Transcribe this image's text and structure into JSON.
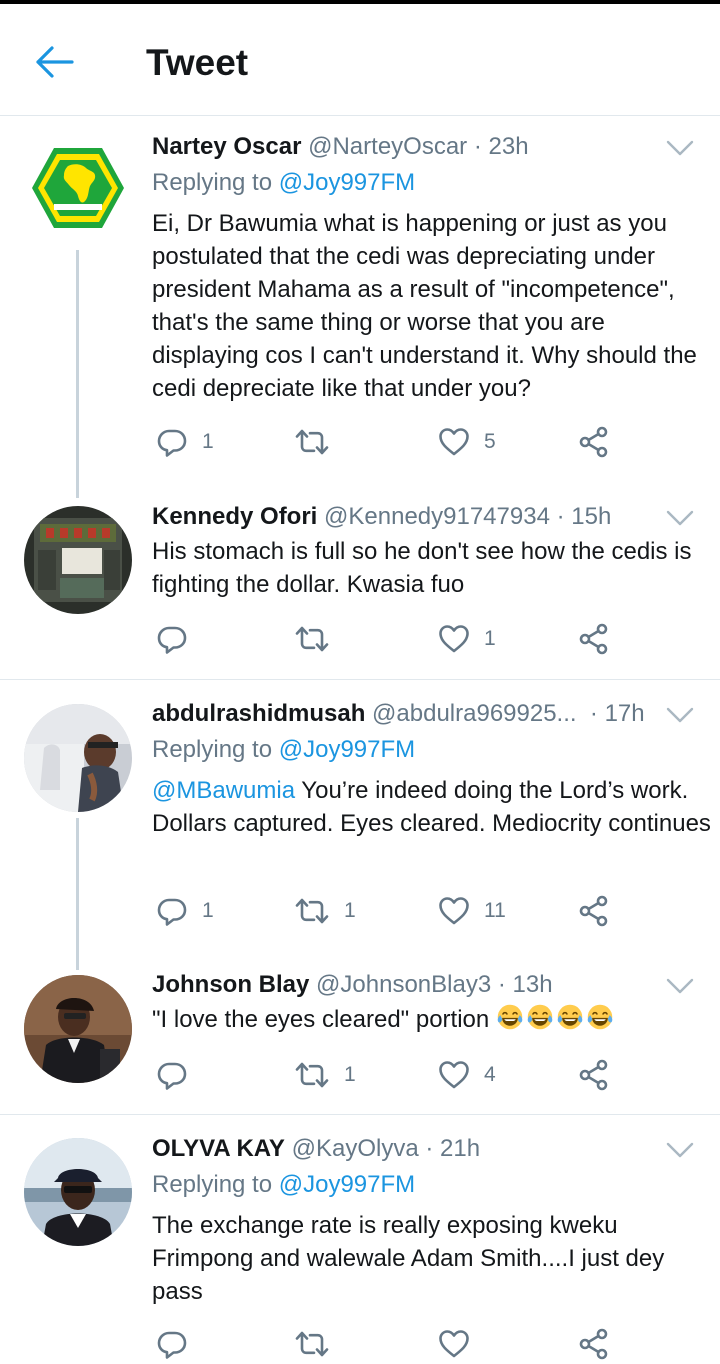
{
  "header": {
    "title": "Tweet"
  },
  "replying_prefix": "Replying to",
  "tweets": [
    {
      "name": "Nartey Oscar",
      "handle": "@NarteyOscar",
      "time": "23h",
      "replying_to": "@Joy997FM",
      "mention": "",
      "text": "Ei, Dr Bawumia what is happening or just as you postulated that the cedi was depreciating under president Mahama as a result of \"incompetence\", that's the same thing or worse that you are displaying cos I can't understand it. Why should the cedi depreciate like that under you?",
      "replies": "1",
      "retweets": "",
      "likes": "5"
    },
    {
      "name": "Kennedy Ofori",
      "handle": "@Kennedy91747934",
      "time": "15h",
      "replying_to": "",
      "mention": "",
      "text": "His stomach is full so he don't see how  the cedis is fighting the dollar. Kwasia fuo",
      "replies": "",
      "retweets": "",
      "likes": "1"
    },
    {
      "name": "abdulrashidmusah",
      "handle": "@abdulra969925...",
      "time": "17h",
      "replying_to": "@Joy997FM",
      "mention": "@MBawumia",
      "text": "You’re indeed doing the Lord’s work. Dollars captured. Eyes cleared. Mediocrity continues",
      "replies": "1",
      "retweets": "1",
      "likes": "11"
    },
    {
      "name": "Johnson Blay",
      "handle": "@JohnsonBlay3",
      "time": "13h",
      "replying_to": "",
      "mention": "",
      "text": "\"I love the eyes cleared\" portion",
      "replies": "",
      "retweets": "1",
      "likes": "4"
    },
    {
      "name": "OLYVA KAY",
      "handle": "@KayOlyva",
      "time": "21h",
      "replying_to": "@Joy997FM",
      "mention": "",
      "text": "The exchange rate is really exposing kweku Frimpong and walewale Adam Smith....I just dey pass",
      "replies": "",
      "retweets": "",
      "likes": ""
    }
  ],
  "colors": {
    "accent": "#1b95e0",
    "muted": "#657786",
    "text": "#14171a",
    "divider": "#e1e8ed"
  },
  "icons": [
    "back-arrow-icon",
    "chevron-down-icon",
    "reply-icon",
    "retweet-icon",
    "like-icon",
    "share-icon",
    "laughing-emoji-icon"
  ]
}
